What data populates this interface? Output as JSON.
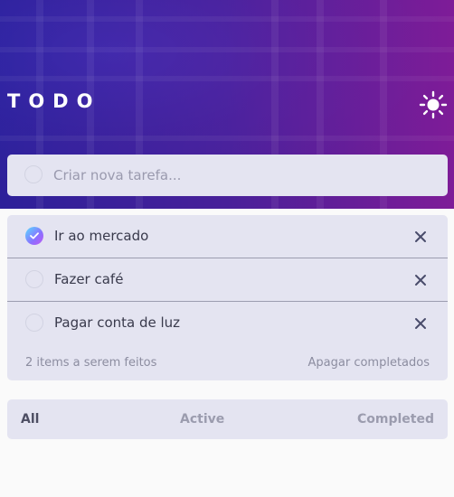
{
  "app": {
    "title": "TODO",
    "theme_toggle_icon": "sun-icon"
  },
  "new_task": {
    "placeholder": "Criar nova tarefa..."
  },
  "todos": [
    {
      "label": "Ir ao mercado",
      "completed": true
    },
    {
      "label": "Fazer café",
      "completed": false
    },
    {
      "label": "Pagar conta de luz",
      "completed": false
    }
  ],
  "footer": {
    "items_left": "2 items a serem feitos",
    "clear_completed": "Apagar completados"
  },
  "filters": {
    "all": "All",
    "active": "Active",
    "completed": "Completed",
    "selected": "all"
  },
  "colors": {
    "check_gradient_start": "#57ddff",
    "check_gradient_end": "#c058f3",
    "card_bg": "#e4e4f1"
  }
}
